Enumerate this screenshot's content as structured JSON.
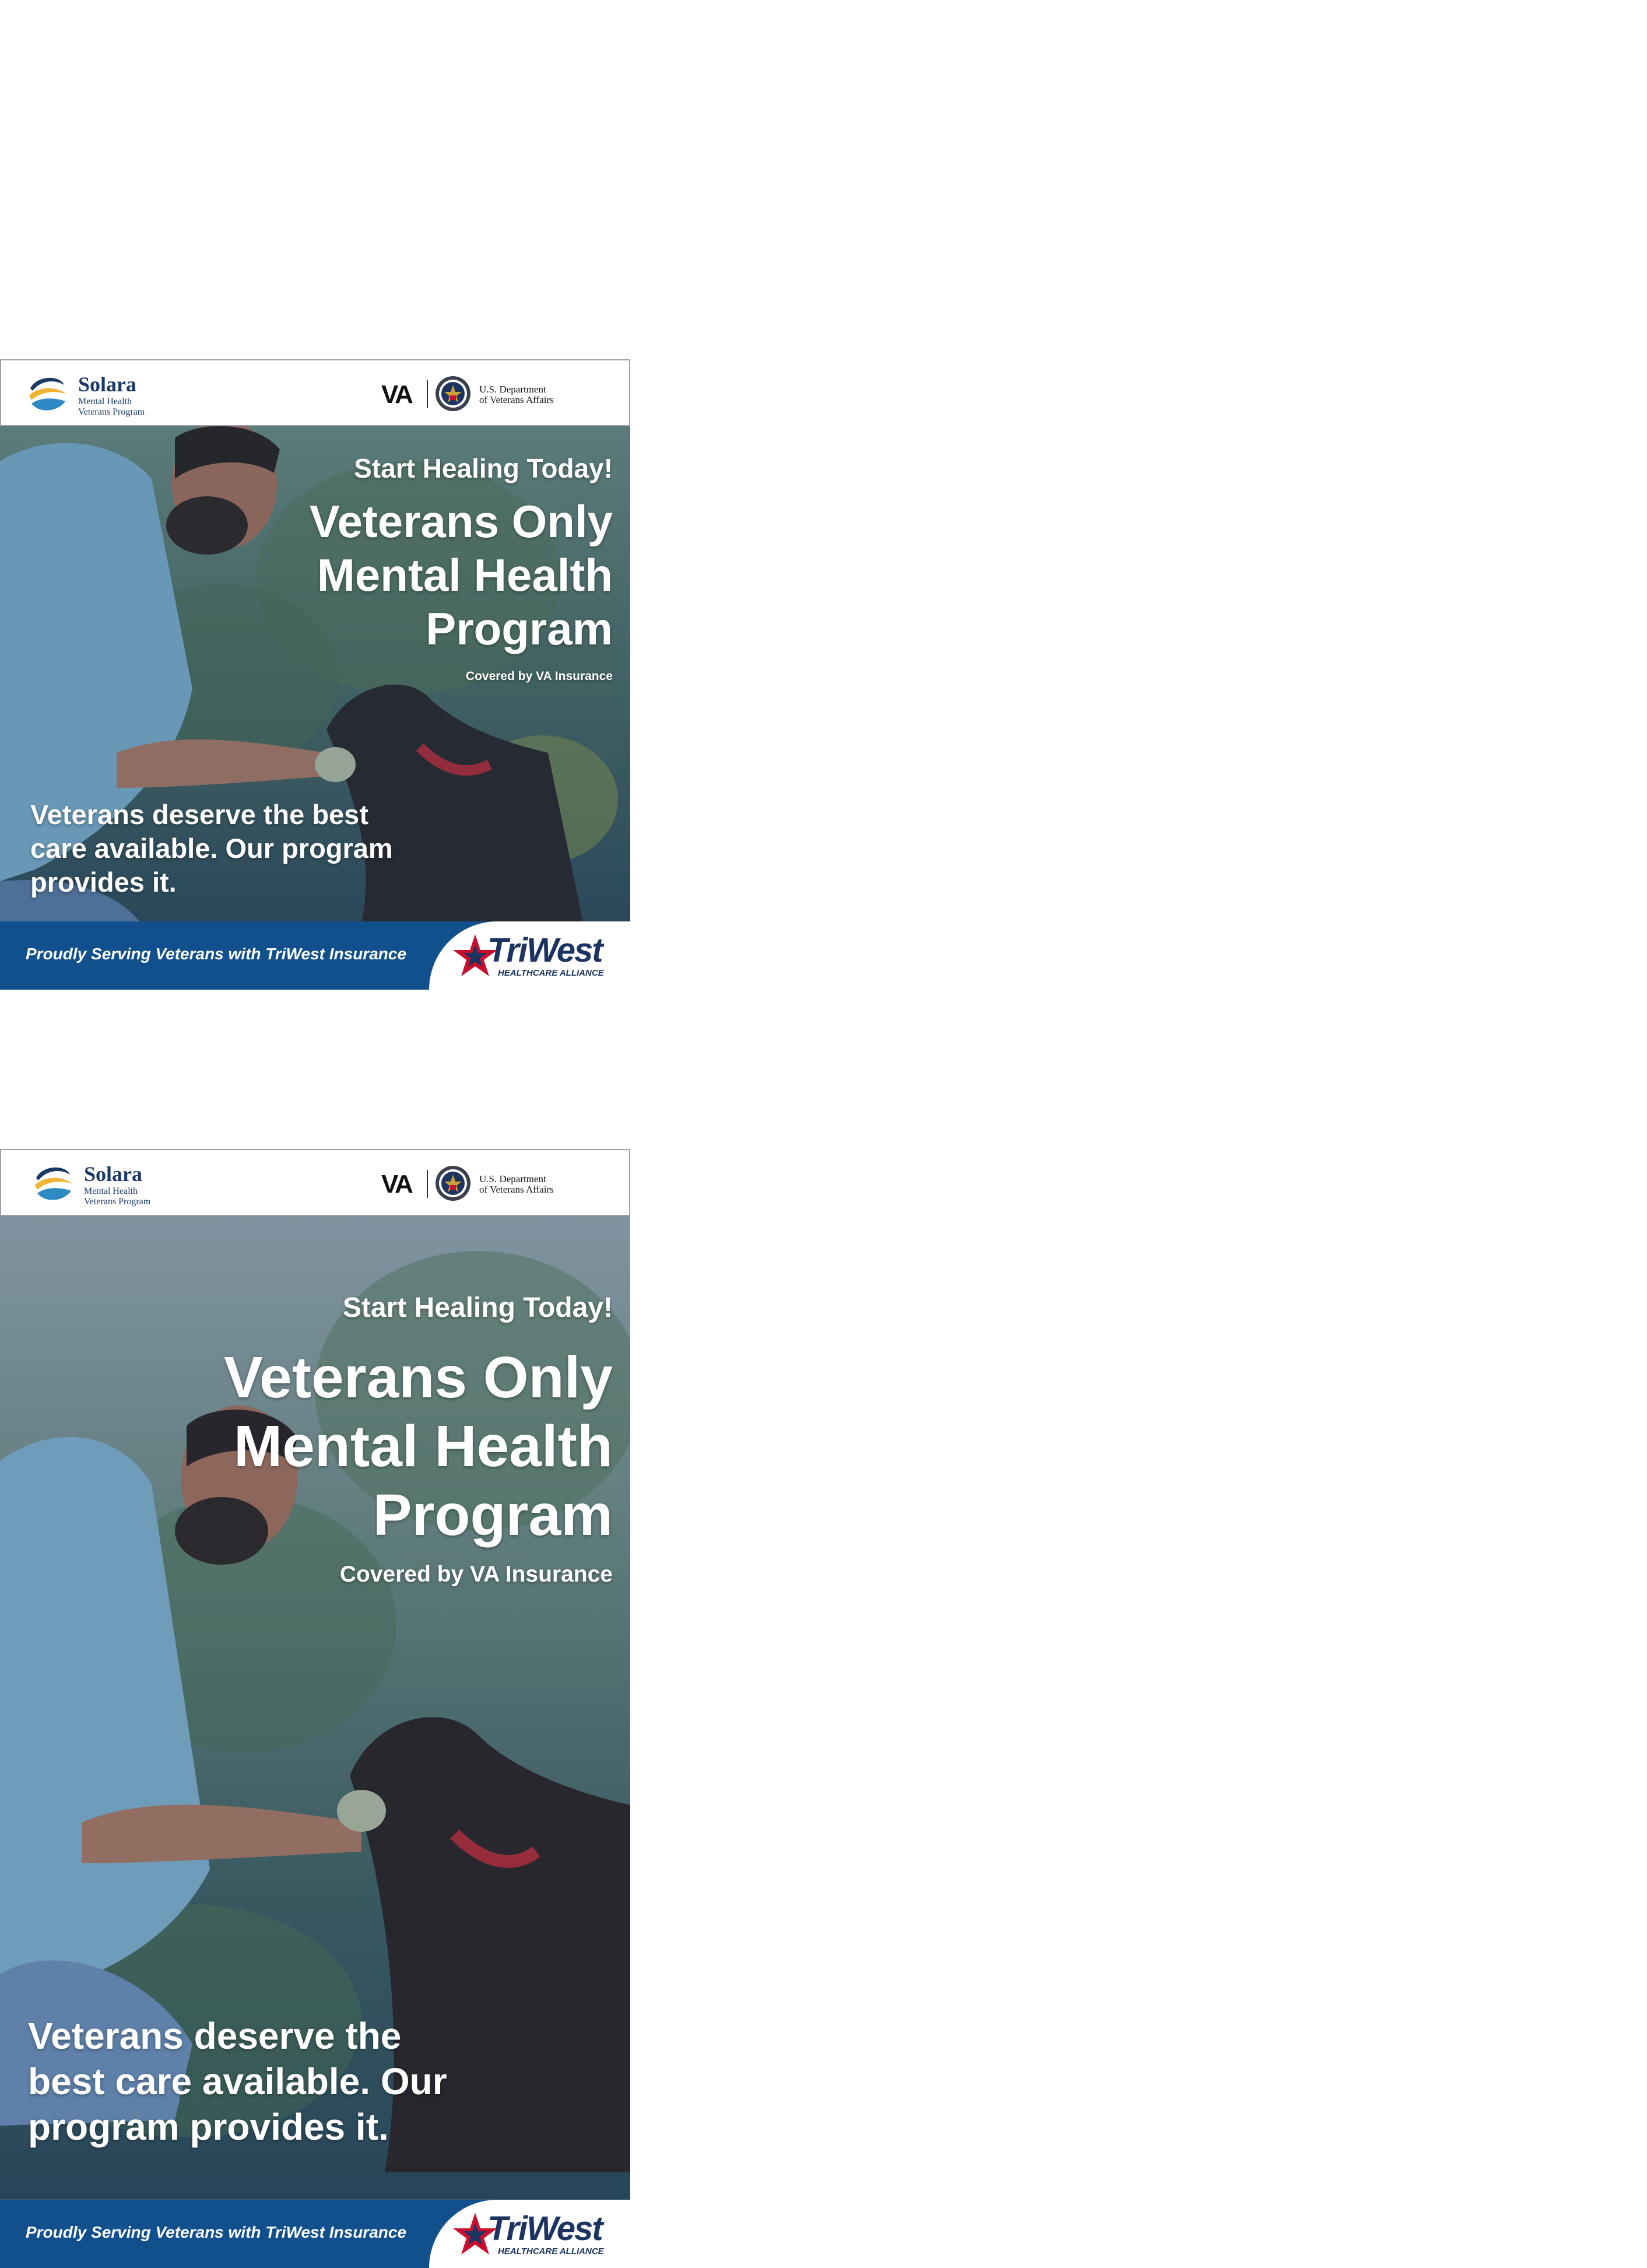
{
  "brand": {
    "solara_name": "Solara",
    "solara_line1": "Mental Health",
    "solara_line2": "Veterans Program",
    "va_mark": "VA",
    "va_line1": "U.S. Department",
    "va_line2": "of Veterans Affairs",
    "triwest_name": "TriWest",
    "triwest_sub": "HEALTHCARE ALLIANCE"
  },
  "ads": [
    {
      "kicker": "Start Healing Today!",
      "headline": [
        "Veterans Only",
        "Mental Health",
        "Program"
      ],
      "covered": "Covered by VA Insurance",
      "body": [
        "Veterans deserve the best",
        "care available. Our program",
        "provides it."
      ],
      "footer": "Proudly Serving Veterans with TriWest Insurance"
    },
    {
      "kicker": "Start Healing Today!",
      "headline": [
        "Veterans Only",
        "Mental Health",
        "Program"
      ],
      "covered": "Covered by VA Insurance",
      "body": [
        "Veterans deserve the",
        "best care available. Our",
        "program provides it."
      ],
      "footer": "Proudly Serving Veterans with TriWest Insurance"
    }
  ],
  "colors": {
    "navy": "#1c3966",
    "footer_blue": "#11508d",
    "triwest_red": "#c8102e",
    "solara_gold": "#f2b233"
  }
}
